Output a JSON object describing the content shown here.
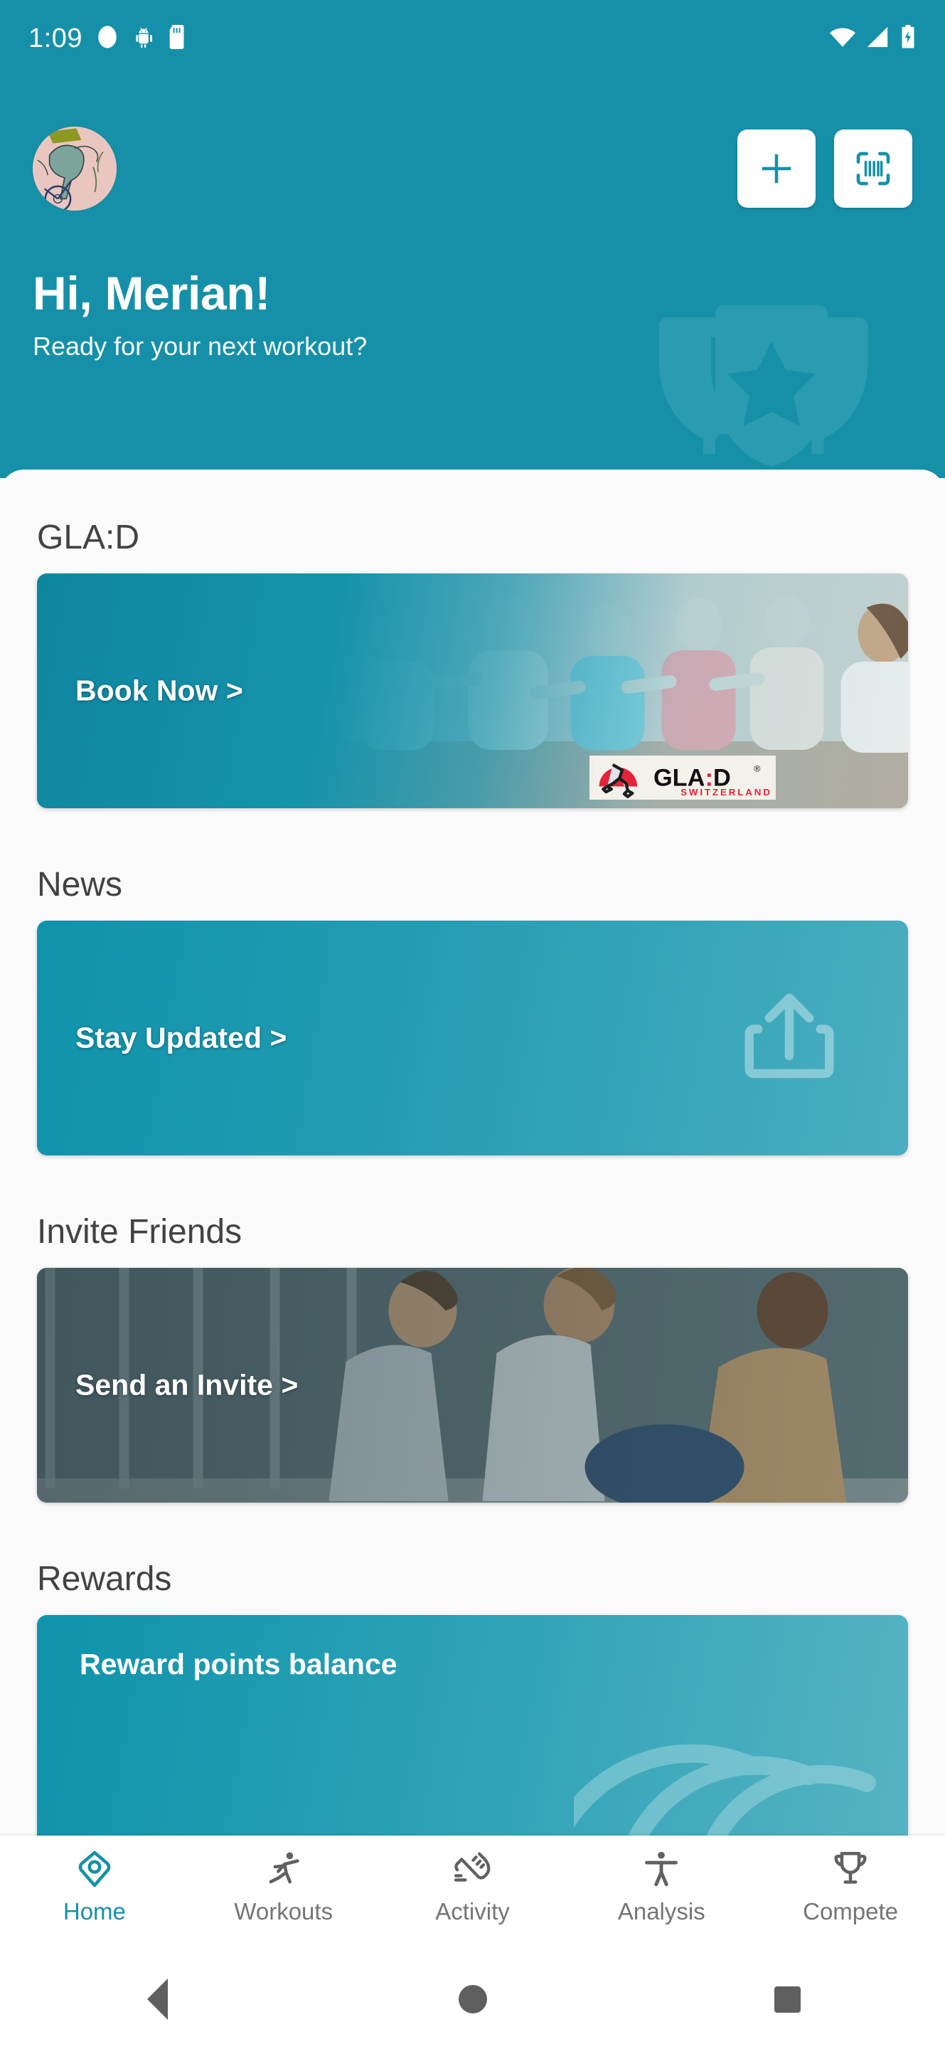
{
  "status_bar": {
    "time": "1:09",
    "icons": [
      "recording-dot-icon",
      "android-debug-icon",
      "sd-card-icon"
    ],
    "right_icons": [
      "wifi-icon",
      "cellular-signal-icon",
      "battery-charging-icon"
    ]
  },
  "header": {
    "avatar_alt": "user-avatar",
    "add_button": "add-icon",
    "scan_button": "barcode-scan-icon",
    "greeting": "Hi, Merian!",
    "subtitle": "Ready for your next workout?",
    "watermark": "trophy-star-icon",
    "background_color": "#1690a8"
  },
  "sections": [
    {
      "title": "GLA:D",
      "card": {
        "name": "glad-card",
        "label": "Book Now >",
        "logo": {
          "brand": "GLA:D",
          "registered": "®",
          "country": "SWITZERLAND",
          "accent_color": "#e2253a"
        }
      }
    },
    {
      "title": "News",
      "card": {
        "name": "news-card",
        "label": "Stay Updated >",
        "icon": "share-upload-icon"
      }
    },
    {
      "title": "Invite Friends",
      "card": {
        "name": "invite-friends-card",
        "label": "Send an Invite >"
      }
    },
    {
      "title": "Rewards",
      "card": {
        "name": "rewards-card",
        "label": "Reward points balance",
        "icon": "waves-icon"
      }
    }
  ],
  "bottom_nav": {
    "active_color": "#1690a8",
    "inactive_color": "#757575",
    "items": [
      {
        "label": "Home",
        "icon": "location-pin-icon",
        "active": true
      },
      {
        "label": "Workouts",
        "icon": "stretching-person-icon",
        "active": false
      },
      {
        "label": "Activity",
        "icon": "running-shoe-icon",
        "active": false
      },
      {
        "label": "Analysis",
        "icon": "body-person-icon",
        "active": false
      },
      {
        "label": "Compete",
        "icon": "trophy-icon",
        "active": false
      }
    ]
  },
  "system_nav": {
    "back": "back-triangle-icon",
    "home": "home-circle-icon",
    "recents": "recents-square-icon"
  }
}
